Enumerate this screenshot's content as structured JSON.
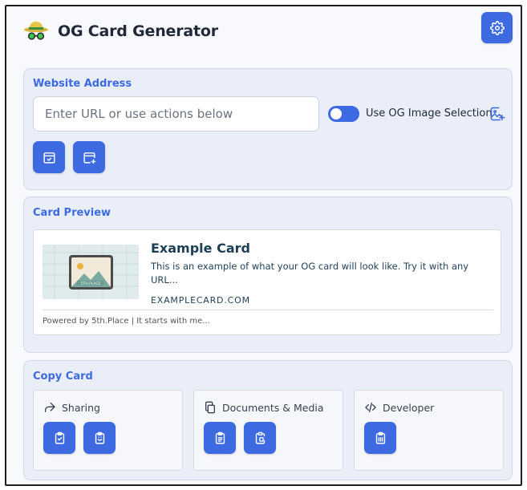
{
  "app": {
    "title": "OG Card Generator",
    "logo_icon": "detective-hat-icon",
    "settings_icon": "gear-icon"
  },
  "address": {
    "title": "Website Address",
    "url_placeholder": "Enter URL or use actions below",
    "url_value": "",
    "toggle_label": "Use OG Image Selection",
    "toggle_on": true,
    "image_select_icon": "image-add-icon",
    "action_icons": [
      "calendar-check-icon",
      "calendar-add-icon"
    ]
  },
  "preview": {
    "title": "Card Preview",
    "card": {
      "title": "Example Card",
      "description": "This is an example of what your OG card will look like. Try it with any URL...",
      "domain": "EXAMPLECARD.COM",
      "footer": "Powered by 5th.Place | It starts with me...",
      "image_icon": "placeholder-image-icon",
      "image_caption": "5TH.PLACE"
    }
  },
  "copy": {
    "title": "Copy Card",
    "groups": [
      {
        "label": "Sharing",
        "icon": "share-arrow-icon",
        "buttons": [
          "clipboard-check-icon",
          "clipboard-smile-icon"
        ]
      },
      {
        "label": "Documents & Media",
        "icon": "copy-documents-icon",
        "buttons": [
          "clipboard-text-icon",
          "clipboard-image-icon"
        ]
      },
      {
        "label": "Developer",
        "icon": "code-icon",
        "buttons": [
          "clipboard-code-icon"
        ]
      }
    ]
  },
  "colors": {
    "accent": "#3d6ae0",
    "section_bg": "#e9eef8",
    "page_bg": "#f7f9fd",
    "card_text": "#1d3f56"
  }
}
